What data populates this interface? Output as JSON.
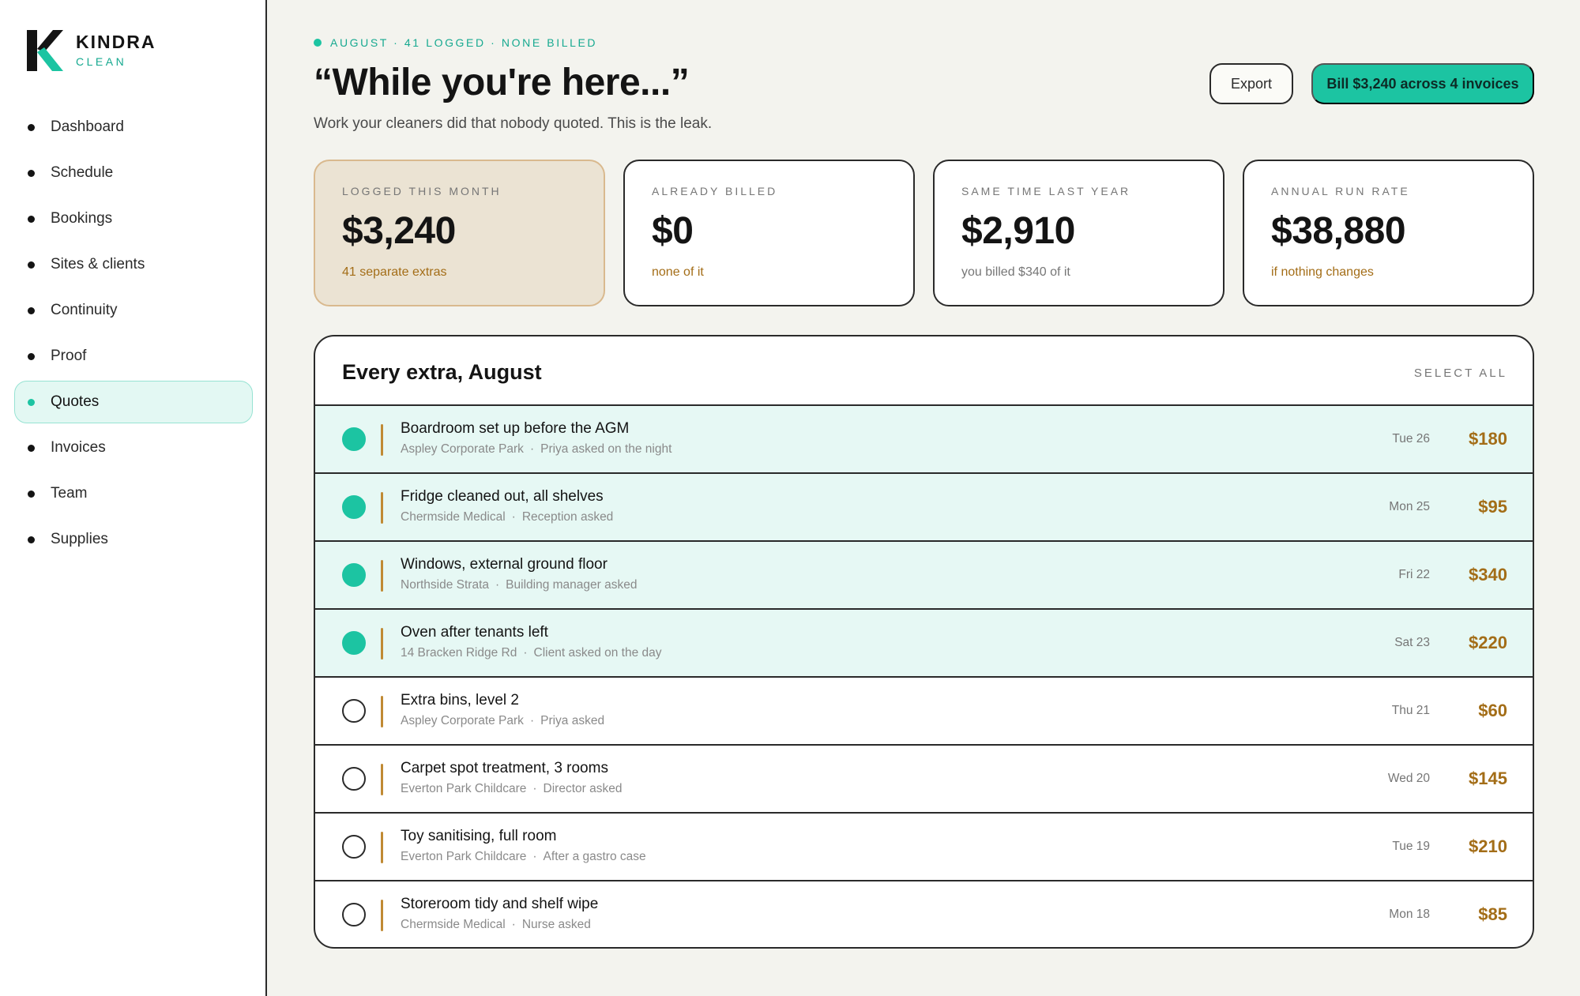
{
  "brand": {
    "name": "KINDRA",
    "sub": "CLEAN"
  },
  "colors": {
    "accent": "#1cc4a2",
    "amount": "#a36d17",
    "highlight_card": "#ebe3d3"
  },
  "nav": {
    "items": [
      {
        "label": "Dashboard"
      },
      {
        "label": "Schedule"
      },
      {
        "label": "Bookings"
      },
      {
        "label": "Sites & clients"
      },
      {
        "label": "Continuity"
      },
      {
        "label": "Proof"
      },
      {
        "label": "Quotes",
        "active": true
      },
      {
        "label": "Invoices"
      },
      {
        "label": "Team"
      },
      {
        "label": "Supplies"
      }
    ]
  },
  "header": {
    "eyebrow": "AUGUST · 41 LOGGED · NONE BILLED",
    "title": "“While you're here...”",
    "subtitle": "Work your cleaners did that nobody quoted. This is the leak.",
    "export_label": "Export",
    "bill_label": "Bill $3,240 across 4 invoices"
  },
  "stats": [
    {
      "label": "LOGGED THIS MONTH",
      "value": "$3,240",
      "note": "41 separate extras"
    },
    {
      "label": "ALREADY BILLED",
      "value": "$0",
      "note": "none of it"
    },
    {
      "label": "SAME TIME LAST YEAR",
      "value": "$2,910",
      "note": "you billed $340 of it"
    },
    {
      "label": "ANNUAL RUN RATE",
      "value": "$38,880",
      "note": "if nothing changes"
    }
  ],
  "table": {
    "title": "Every extra, August",
    "select_all": "SELECT ALL",
    "rows": [
      {
        "title": "Boardroom set up before the AGM",
        "site": "Aspley Corporate Park",
        "requester": "Priya asked on the night",
        "date": "Tue 26",
        "amount": "$180",
        "selected": true
      },
      {
        "title": "Fridge cleaned out, all shelves",
        "site": "Chermside Medical",
        "requester": "Reception asked",
        "date": "Mon 25",
        "amount": "$95",
        "selected": true
      },
      {
        "title": "Windows, external ground floor",
        "site": "Northside Strata",
        "requester": "Building manager asked",
        "date": "Fri 22",
        "amount": "$340",
        "selected": true
      },
      {
        "title": "Oven after tenants left",
        "site": "14 Bracken Ridge Rd",
        "requester": "Client asked on the day",
        "date": "Sat 23",
        "amount": "$220",
        "selected": true
      },
      {
        "title": "Extra bins, level 2",
        "site": "Aspley Corporate Park",
        "requester": "Priya asked",
        "date": "Thu 21",
        "amount": "$60",
        "selected": false
      },
      {
        "title": "Carpet spot treatment, 3 rooms",
        "site": "Everton Park Childcare",
        "requester": "Director asked",
        "date": "Wed 20",
        "amount": "$145",
        "selected": false
      },
      {
        "title": "Toy sanitising, full room",
        "site": "Everton Park Childcare",
        "requester": "After a gastro case",
        "date": "Tue 19",
        "amount": "$210",
        "selected": false
      },
      {
        "title": "Storeroom tidy and shelf wipe",
        "site": "Chermside Medical",
        "requester": "Nurse asked",
        "date": "Mon 18",
        "amount": "$85",
        "selected": false
      }
    ]
  }
}
